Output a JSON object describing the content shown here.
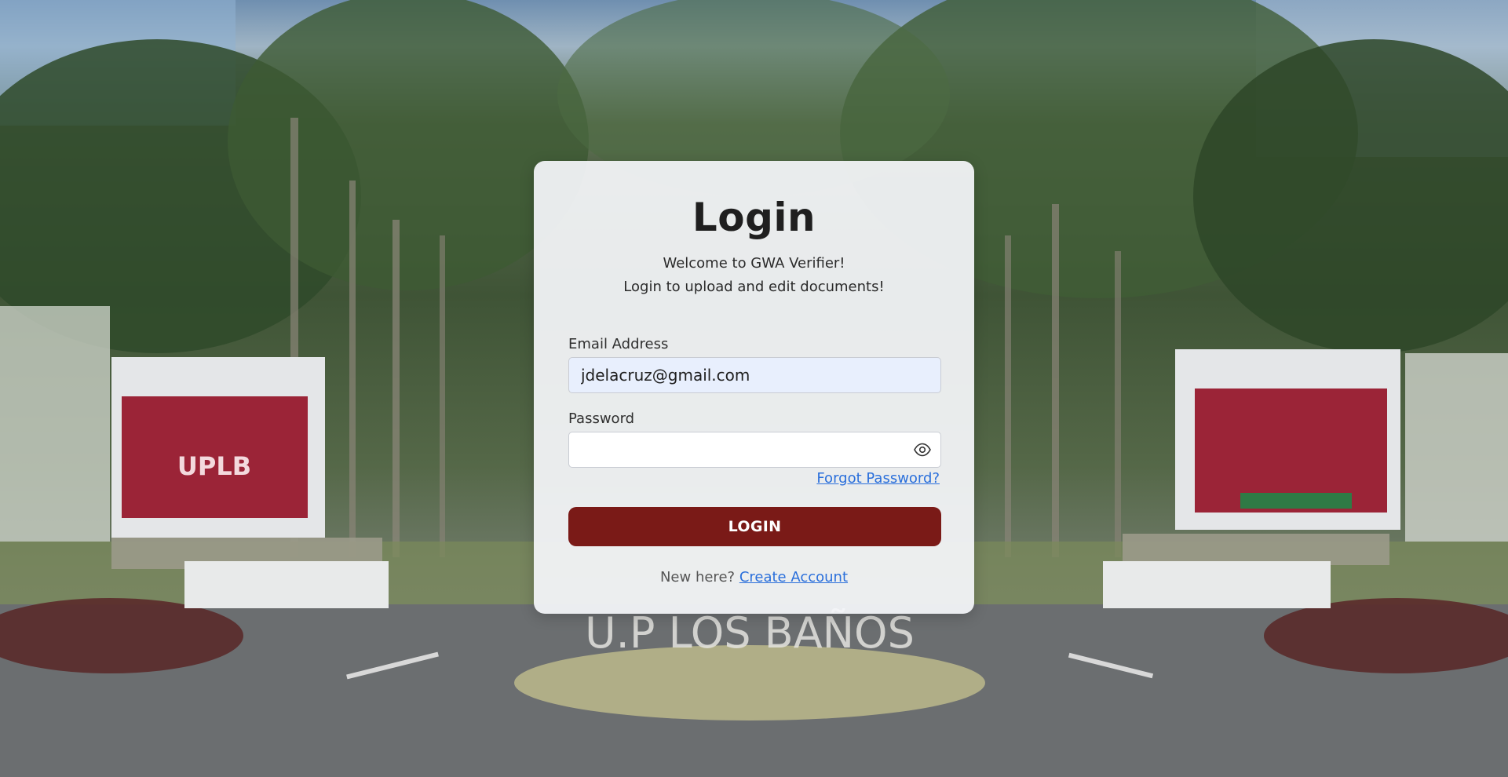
{
  "login": {
    "title": "Login",
    "welcome_line": "Welcome to GWA Verifier!",
    "instruction_line": "Login to upload and edit documents!",
    "email_label": "Email Address",
    "email_value": "jdelacruz@gmail.com",
    "password_label": "Password",
    "password_value": "",
    "forgot_password": "Forgot Password?",
    "login_button": "LOGIN",
    "new_here": "New here?",
    "create_account": "Create Account"
  },
  "background": {
    "signage_text": "U.P LOS BAÑOS",
    "left_sign_logo": "UPLB"
  },
  "colors": {
    "button": "#7a1a17",
    "link": "#2a6fdb",
    "email_field_bg": "#e8effd"
  },
  "icons": {
    "password_toggle": "eye-icon"
  }
}
